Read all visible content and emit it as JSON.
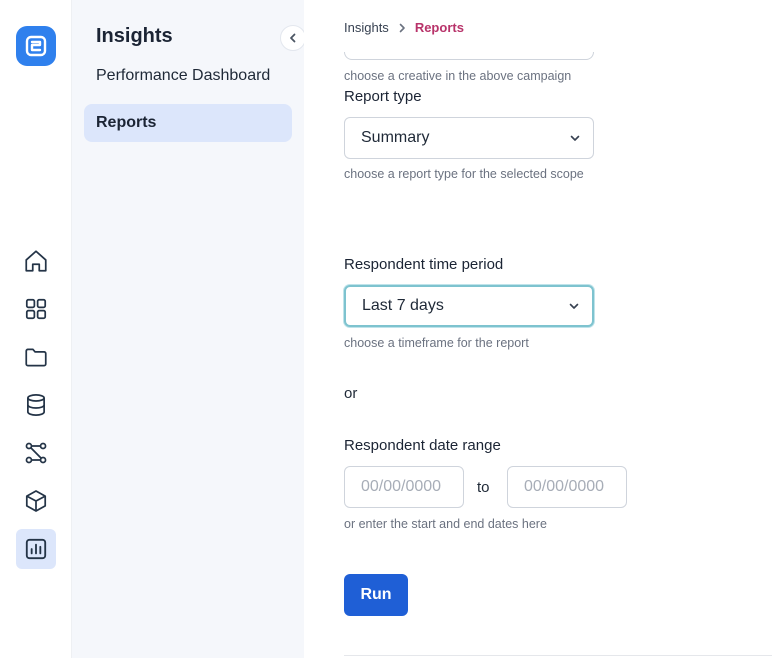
{
  "sidebar": {
    "title": "Insights",
    "items": [
      {
        "label": "Performance Dashboard"
      },
      {
        "label": "Reports"
      }
    ]
  },
  "rail": {
    "icons": [
      "home-icon",
      "grid-icon",
      "folder-icon",
      "database-icon",
      "workflow-icon",
      "cube-icon",
      "chart-icon"
    ],
    "active": "chart-icon"
  },
  "breadcrumb": {
    "parent": "Insights",
    "current": "Reports"
  },
  "form": {
    "creative_help": "choose a creative in the above campaign",
    "report_type": {
      "label": "Report type",
      "value": "Summary",
      "help": "choose a report type for the selected scope"
    },
    "time_period": {
      "label": "Respondent time period",
      "value": "Last 7 days",
      "help": "choose a timeframe for the report"
    },
    "or_text": "or",
    "date_range": {
      "label": "Respondent date range",
      "start_placeholder": "00/00/0000",
      "end_placeholder": "00/00/0000",
      "to_text": "to",
      "help": "or enter the start and end dates here"
    },
    "run_label": "Run"
  },
  "colors": {
    "primary": "#1f5fd6",
    "logo": "#2f80ed",
    "breadcrumb_current": "#b8336a",
    "active_bg": "#dce6fb",
    "focus_ring": "#7ec3cf"
  }
}
